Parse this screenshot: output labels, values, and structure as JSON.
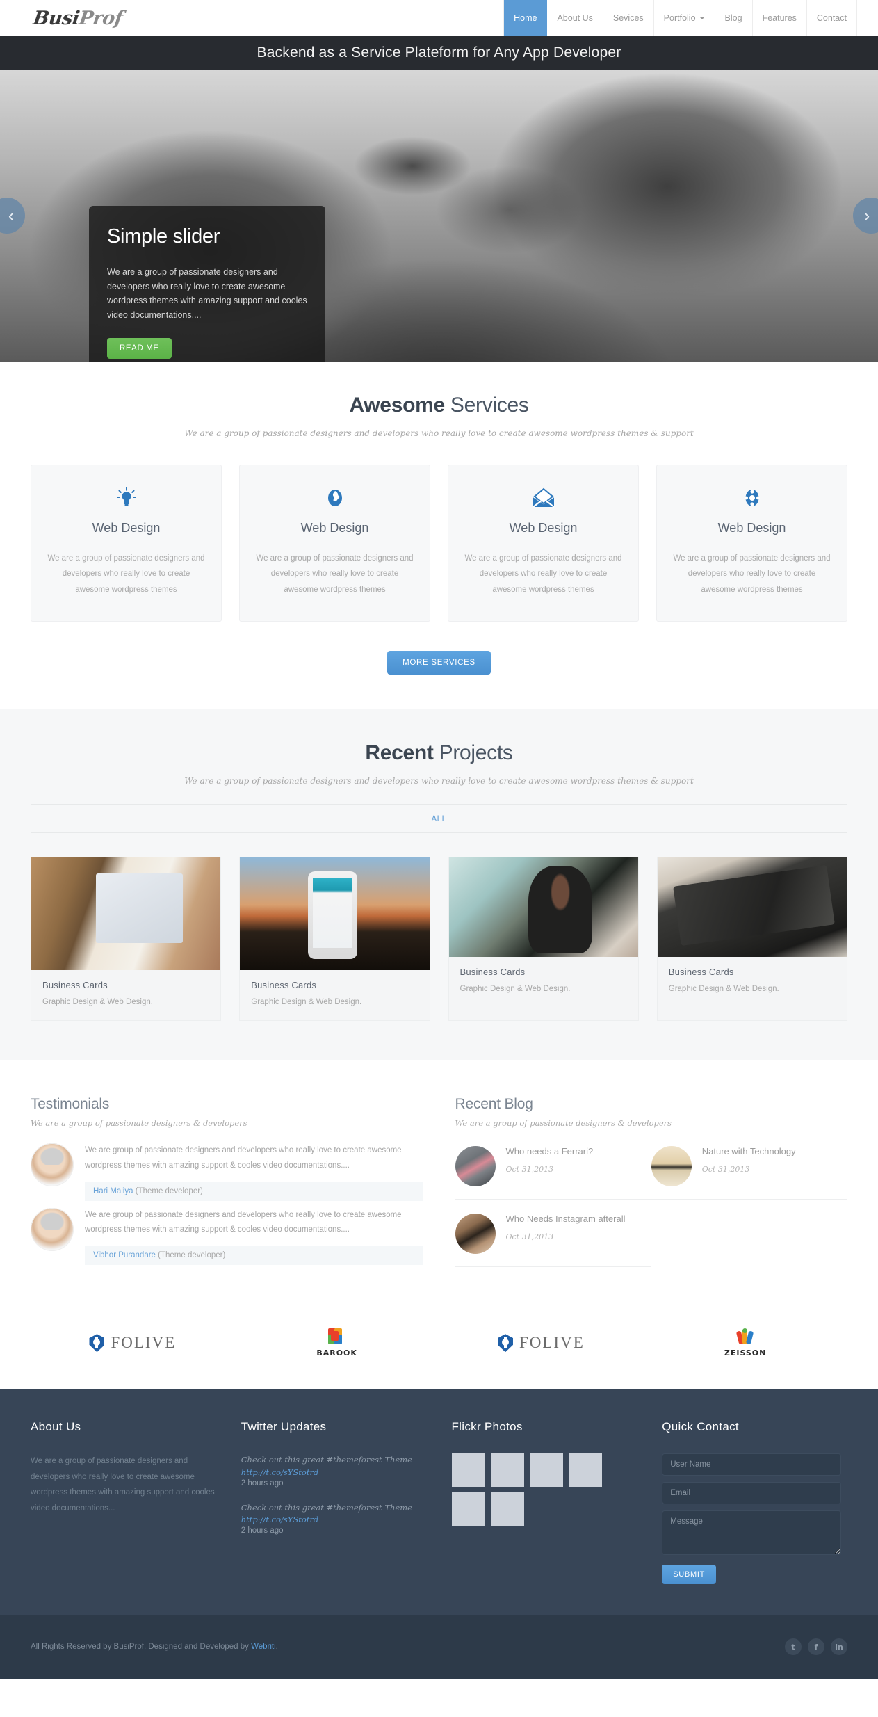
{
  "header": {
    "logo": "BusiProf",
    "logo_part1": "Busi",
    "logo_part2": "Prof",
    "nav": [
      {
        "label": "Home",
        "active": true,
        "caret": false
      },
      {
        "label": "About Us",
        "active": false,
        "caret": false
      },
      {
        "label": "Sevices",
        "active": false,
        "caret": false
      },
      {
        "label": "Portfolio",
        "active": false,
        "caret": true
      },
      {
        "label": "Blog",
        "active": false,
        "caret": false
      },
      {
        "label": "Features",
        "active": false,
        "caret": false
      },
      {
        "label": "Contact",
        "active": false,
        "caret": false
      }
    ],
    "accent_color": "#5b9bd5"
  },
  "titlebar": {
    "headline": "Backend as a Service Plateform for Any App Developer"
  },
  "slider": {
    "caption_title": "Simple slider",
    "caption_text": "We are a group of passionate designers and developers who really love to create awesome wordpress themes with amazing support and cooles video documentations....",
    "button_label": "READ ME",
    "button_color": "#5bb247",
    "prev_label": "‹",
    "next_label": "›"
  },
  "services": {
    "title_bold": "Awesome",
    "title_rest": " Services",
    "subtitle": "We are a group of passionate designers and developers who really love to create awesome wordpress themes & support",
    "cards": [
      {
        "icon": "lightbulb-icon",
        "title": "Web Design",
        "text": "We are a group of passionate designers and developers who really love to create awesome wordpress themes"
      },
      {
        "icon": "globe-icon",
        "title": "Web Design",
        "text": "We are a group of passionate designers and developers who really love to create awesome wordpress themes"
      },
      {
        "icon": "envelope-icon",
        "title": "Web Design",
        "text": "We are a group of passionate designers and developers who really love to create awesome wordpress themes"
      },
      {
        "icon": "lifebuoy-icon",
        "title": "Web Design",
        "text": "We are a group of passionate designers and developers who really love to create awesome wordpress themes"
      }
    ],
    "more_button": "MORE SERVICES"
  },
  "projects": {
    "title_bold": "Recent",
    "title_rest": " Projects",
    "subtitle": "We are a group of passionate designers and developers who really love to create awesome wordpress themes & support",
    "filter": "ALL",
    "items": [
      {
        "title": "Business Cards",
        "meta": "Graphic Design & Web Design."
      },
      {
        "title": "Business Cards",
        "meta": "Graphic Design & Web Design."
      },
      {
        "title": "Business Cards",
        "meta": "Graphic Design & Web Design."
      },
      {
        "title": "Business Cards",
        "meta": "Graphic Design & Web Design."
      }
    ]
  },
  "testimonials": {
    "title": "Testimonials",
    "subtitle": "We are a group of passionate designers & developers",
    "items": [
      {
        "text": "We are group of passionate designers and developers who really love to create awesome wordpress themes with amazing support & cooles video documentations....",
        "name": "Hari Maliya",
        "role": "(Theme developer)"
      },
      {
        "text": "We are group of passionate designers and developers who really love to create awesome wordpress themes with amazing support & cooles video documentations....",
        "name": "Vibhor Purandare",
        "role": "(Theme developer)"
      }
    ]
  },
  "blog": {
    "title": "Recent Blog",
    "subtitle": "We are a group of passionate designers & developers",
    "items": [
      {
        "title": "Who needs a Ferrari?",
        "date": "Oct 31,2013"
      },
      {
        "title": "Nature with Technology",
        "date": "Oct 31,2013"
      },
      {
        "title": "Who Needs Instagram afterall",
        "date": "Oct 31,2013"
      }
    ]
  },
  "clients": [
    {
      "name": "FOLIVE",
      "mark": "folive-mark-icon"
    },
    {
      "name": "BAROOK",
      "mark": "barook-mark-icon"
    },
    {
      "name": "FOLIVE",
      "mark": "folive-mark-icon"
    },
    {
      "name": "ZEISSON",
      "mark": "zeisson-mark-icon"
    }
  ],
  "footer": {
    "about": {
      "title": "About Us",
      "text": "We are a group of passionate designers and developers who really love to create awesome wordpress themes with amazing support and cooles video documentations..."
    },
    "twitter": {
      "title": "Twitter Updates",
      "tweets": [
        {
          "text": "Check out this great #themeforest Theme",
          "link": "http://t.co/sYStotrd",
          "ago": "2 hours ago"
        },
        {
          "text": "Check out this great #themeforest Theme",
          "link": "http://t.co/sYStotrd",
          "ago": "2 hours ago"
        }
      ]
    },
    "flickr": {
      "title": "Flickr Photos",
      "count": 6
    },
    "contact": {
      "title": "Quick Contact",
      "name_placeholder": "User Name",
      "name_value": "",
      "email_placeholder": "Email",
      "email_value": "",
      "message_placeholder": "Message",
      "message_value": "",
      "submit_label": "SUBMIT"
    }
  },
  "copyright": {
    "text_before": "All Rights Reserved by BusiProf. Designed and Developed by ",
    "link": "Webriti",
    "text_after": ".",
    "social": [
      {
        "name": "twitter-icon",
        "glyph": "t"
      },
      {
        "name": "facebook-icon",
        "glyph": "f"
      },
      {
        "name": "linkedin-icon",
        "glyph": "in"
      }
    ]
  }
}
